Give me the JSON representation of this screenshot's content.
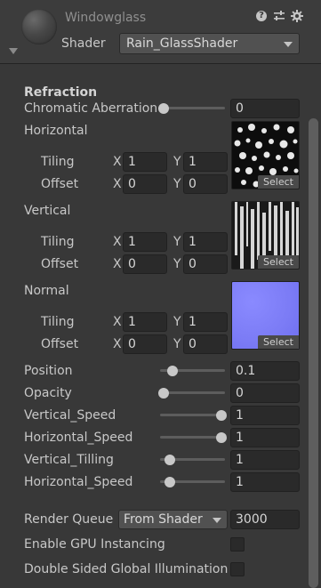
{
  "header": {
    "material_name": "Windowglass",
    "shader_label": "Shader",
    "shader_value": "Rain_GlassShader",
    "help_icon": "?"
  },
  "sections": {
    "refraction_title": "Refraction",
    "chromatic_label": "Chromatic Aberration",
    "chromatic_value": "0",
    "chromatic_fill": 0.0
  },
  "textures": [
    {
      "name": "Horizontal",
      "tiling_label": "Tiling",
      "offset_label": "Offset",
      "tiling_x": "1",
      "tiling_y": "1",
      "offset_x": "0",
      "offset_y": "0",
      "select_label": "Select"
    },
    {
      "name": "Vertical",
      "tiling_label": "Tiling",
      "offset_label": "Offset",
      "tiling_x": "1",
      "tiling_y": "1",
      "offset_x": "0",
      "offset_y": "0",
      "select_label": "Select"
    },
    {
      "name": "Normal",
      "tiling_label": "Tiling",
      "offset_label": "Offset",
      "tiling_x": "1",
      "tiling_y": "1",
      "offset_x": "0",
      "offset_y": "0",
      "select_label": "Select"
    }
  ],
  "axis": {
    "x": "X",
    "y": "Y"
  },
  "sliders": [
    {
      "label": "Position",
      "value": "0.1",
      "fill": 0.15
    },
    {
      "label": "Opacity",
      "value": "0",
      "fill": 0.0
    },
    {
      "label": "Vertical_Speed",
      "value": "1",
      "fill": 1.0
    },
    {
      "label": "Horizontal_Speed",
      "value": "1",
      "fill": 1.0
    },
    {
      "label": "Vertical_Tilling",
      "value": "1",
      "fill": 0.1
    },
    {
      "label": "Horizontal_Speed",
      "value": "1",
      "fill": 0.1
    }
  ],
  "render_queue": {
    "label": "Render Queue",
    "mode": "From Shader",
    "value": "3000"
  },
  "options": {
    "gpu_instancing_label": "Enable GPU Instancing",
    "gpu_instancing_checked": false,
    "double_sided_gi_label": "Double Sided Global Illumination",
    "double_sided_gi_checked": false
  },
  "colors": {
    "normal_map": "#7b7bf5",
    "knob": "#c8c8c8"
  }
}
